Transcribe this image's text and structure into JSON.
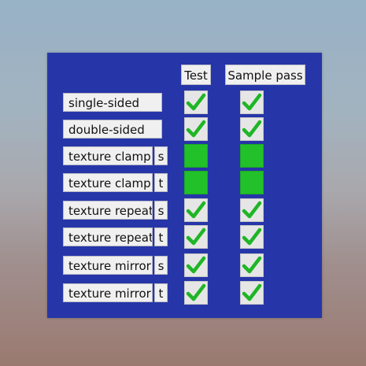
{
  "headers": {
    "test": "Test",
    "sample": "Sample pass"
  },
  "rows": [
    {
      "label": "single-sided",
      "axis": "",
      "test": "check",
      "sample": "check"
    },
    {
      "label": "double-sided",
      "axis": "",
      "test": "check",
      "sample": "check"
    },
    {
      "label": "texture clamp",
      "axis": "s",
      "test": "solid",
      "sample": "solid"
    },
    {
      "label": "texture clamp",
      "axis": "t",
      "test": "solid",
      "sample": "solid"
    },
    {
      "label": "texture repeat",
      "axis": "s",
      "test": "check",
      "sample": "check"
    },
    {
      "label": "texture repeat",
      "axis": "t",
      "test": "check",
      "sample": "check"
    },
    {
      "label": "texture mirror",
      "axis": "s",
      "test": "check",
      "sample": "check"
    },
    {
      "label": "texture mirror",
      "axis": "t",
      "test": "check",
      "sample": "check"
    }
  ],
  "colors": {
    "panel": "#2636a8",
    "pass": "#22c12a"
  },
  "icons": {
    "check": "checkmark-icon",
    "solid": "solid-green-square"
  }
}
